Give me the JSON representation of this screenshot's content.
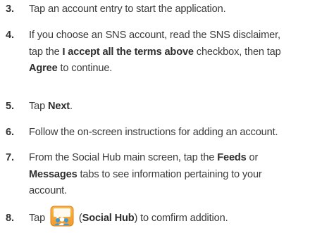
{
  "steps": [
    {
      "number": "3.",
      "lines": [
        [
          {
            "t": "Tap an account entry to start the application.",
            "b": false
          }
        ]
      ]
    },
    {
      "number": "4.",
      "lines": [
        [
          {
            "t": "If you choose an SNS account, read the SNS disclaimer,",
            "b": false
          }
        ],
        [
          {
            "t": "tap the ",
            "b": false
          },
          {
            "t": "I accept all the terms above",
            "b": true
          },
          {
            "t": " checkbox, then tap",
            "b": false
          }
        ],
        [
          {
            "t": "Agree",
            "b": true
          },
          {
            "t": " to continue.",
            "b": false
          }
        ]
      ]
    },
    {
      "number": "5.",
      "lines": [
        [
          {
            "t": "Tap ",
            "b": false
          },
          {
            "t": "Next",
            "b": true
          },
          {
            "t": ".",
            "b": false
          }
        ]
      ]
    },
    {
      "number": "6.",
      "lines": [
        [
          {
            "t": "Follow the on-screen instructions for adding an account.",
            "b": false
          }
        ]
      ]
    },
    {
      "number": "7.",
      "lines": [
        [
          {
            "t": "From the Social Hub main screen, tap the ",
            "b": false
          },
          {
            "t": "Feeds",
            "b": true
          },
          {
            "t": " or",
            "b": false
          }
        ],
        [
          {
            "t": "Messages",
            "b": true
          },
          {
            "t": " tabs to see information pertaining to your",
            "b": false
          }
        ],
        [
          {
            "t": "account.",
            "b": false
          }
        ]
      ]
    },
    {
      "number": "8.",
      "lines": [
        [
          {
            "t": "Tap ",
            "b": false
          },
          {
            "icon": "social-hub-icon"
          },
          {
            "t": " (",
            "b": false
          },
          {
            "t": "Social Hub",
            "b": true
          },
          {
            "t": ") to comfirm addition.",
            "b": false
          }
        ]
      ]
    }
  ],
  "icon_colors": {
    "social_hub_orange": "#f39a2b",
    "social_hub_blue": "#3d9ad9"
  }
}
